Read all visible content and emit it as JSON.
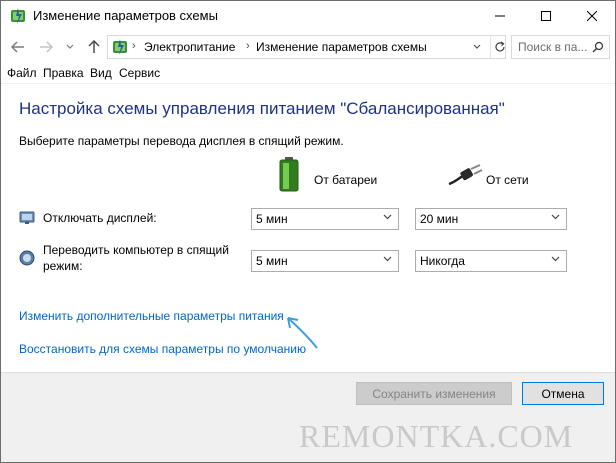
{
  "window": {
    "title": "Изменение параметров схемы",
    "icon": "power-options-icon"
  },
  "address": {
    "crumbs": [
      "Электропитание",
      "Изменение параметров схемы"
    ],
    "search_placeholder": "Поиск в па..."
  },
  "menu": [
    "Файл",
    "Правка",
    "Вид",
    "Сервис"
  ],
  "content": {
    "heading": "Настройка схемы управления питанием \"Сбалансированная\"",
    "subheading": "Выберите параметры перевода дисплея в спящий режим.",
    "columns": {
      "battery": "От батареи",
      "plugged": "От сети"
    },
    "rows": [
      {
        "label": "Отключать дисплей:",
        "battery": "5 мин",
        "plugged": "20 мин"
      },
      {
        "label": "Переводить компьютер в спящий режим:",
        "battery": "5 мин",
        "plugged": "Никогда"
      }
    ],
    "links": {
      "advanced": "Изменить дополнительные параметры питания",
      "restore": "Восстановить для схемы параметры по умолчанию"
    }
  },
  "footer": {
    "save": "Сохранить изменения",
    "cancel": "Отмена"
  },
  "watermark": "REMONTKA.COM",
  "colors": {
    "heading": "#1e3287",
    "link": "#0066cc",
    "annotation_arrow": "#3ba0e0"
  }
}
